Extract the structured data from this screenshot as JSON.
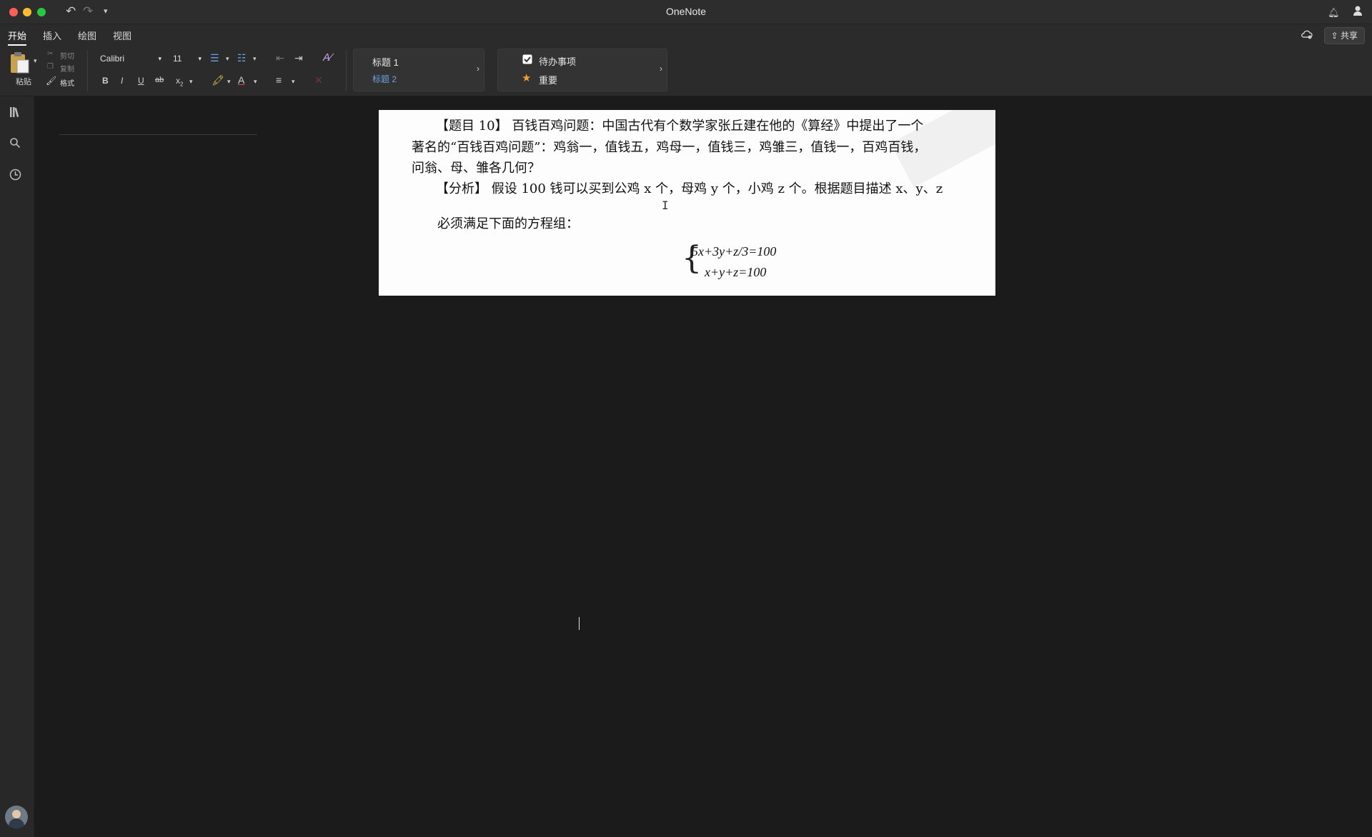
{
  "window": {
    "title": "OneNote"
  },
  "titlebar": {
    "undo_icon": "undo-icon",
    "redo_icon": "redo-icon",
    "customize_icon": "customize-icon"
  },
  "tabs": [
    {
      "label": "开始"
    },
    {
      "label": "插入"
    },
    {
      "label": "绘图"
    },
    {
      "label": "视图"
    }
  ],
  "header_right": {
    "share_label": "共享"
  },
  "ribbon": {
    "paste_label": "粘贴",
    "cut_label": "剪切",
    "copy_label": "复制",
    "format_label": "格式",
    "font_name": "Calibri",
    "font_size": "11",
    "bold": "B",
    "italic": "I",
    "underline": "U",
    "strike": "ab",
    "subscript": "x",
    "styles": [
      {
        "label": "标题 1"
      },
      {
        "label": "标题 2"
      }
    ],
    "tags": [
      {
        "label": "待办事项",
        "icon": "checkbox-icon"
      },
      {
        "label": "重要",
        "icon": "star-icon"
      }
    ]
  },
  "colors": {
    "accent_heading2": "#6aa3e0",
    "star": "#f0a030",
    "checkbox": "#ffffff"
  },
  "document": {
    "lines": [
      "【题目 10】 百钱百鸡问题：中国古代有个数学家张丘建在他的《算经》中提出了一个",
      "著名的“百钱百鸡问题”：鸡翁一，值钱五，鸡母一，值钱三，鸡雏三，值钱一，百鸡百钱，",
      "问翁、母、雏各几何？",
      "【分析】 假设 100 钱可以买到公鸡 x 个，母鸡 y 个，小鸡 z 个。根据题目描述 x、y、z",
      "必须满足下面的方程组："
    ],
    "equations": [
      "5x+3y+z/3=100",
      "x+y+z=100"
    ]
  }
}
